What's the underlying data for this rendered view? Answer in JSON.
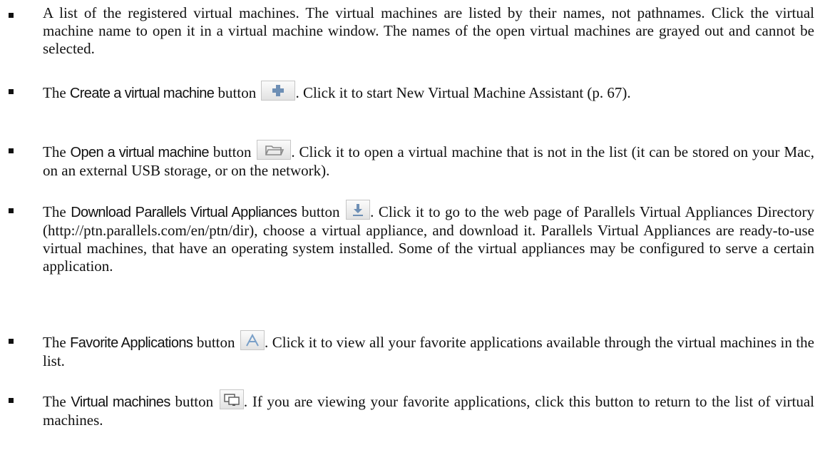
{
  "items": [
    {
      "text": "A list of the registered virtual machines. The virtual machines are listed by their names, not pathnames. Click the virtual machine name to open it in a virtual machine window. The names of the open virtual machines are grayed out and cannot be selected."
    },
    {
      "prefix": "The ",
      "term": "Create a virtual machine",
      "middle": " button ",
      "icon": "plus-icon",
      "suffix": ". Click it to start New Virtual Machine Assistant (p. 67)."
    },
    {
      "prefix": "The ",
      "term": "Open a virtual machine",
      "middle": " button ",
      "icon": "folder-icon",
      "suffix": ". Click it to open a virtual machine that is not in the list (it can be stored on your Mac, on an external USB storage, or on the network)."
    },
    {
      "prefix": "The ",
      "term": "Download Parallels Virtual Appliances",
      "middle": " button ",
      "icon": "download-icon",
      "suffix": ". Click it to go to the web page of Parallels Virtual Appliances Directory (http://ptn.parallels.com/en/ptn/dir), choose a virtual appliance, and download it. Parallels Virtual Appliances are ready-to-use virtual machines, that have an operating system installed. Some of the virtual appliances may be configured to serve a certain application."
    },
    {
      "prefix": "The ",
      "term": "Favorite Applications",
      "middle": " button ",
      "icon": "applications-icon",
      "suffix": ". Click it to view all your favorite applications available through the virtual machines in the list."
    },
    {
      "prefix": "The ",
      "term": "Virtual machines",
      "middle": " button ",
      "icon": "monitor-icon",
      "suffix": ". If you are viewing your favorite applications, click this button to return to the list of virtual machines."
    }
  ]
}
